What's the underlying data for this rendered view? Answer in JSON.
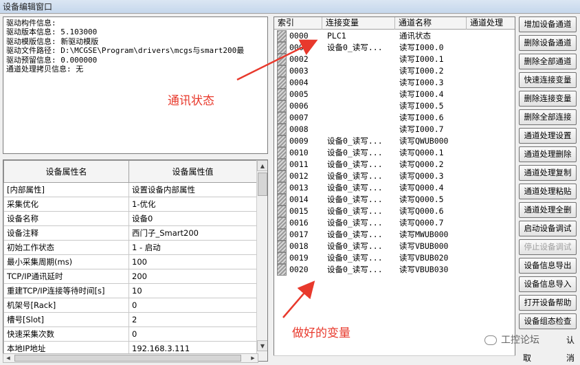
{
  "window": {
    "title": "设备编辑窗口"
  },
  "info_lines": [
    "驱动构件信息:",
    "驱动版本信息: 5.103000",
    "驱动模版信息: 新驱动模版",
    "驱动文件路径: D:\\MCGSE\\Program\\drivers\\mcgs与smart200最",
    "驱动预留信息: 0.000000",
    "通道处理拷贝信息: 无"
  ],
  "props": {
    "headers": [
      "设备属性名",
      "设备属性值"
    ],
    "rows": [
      {
        "name": "[内部属性]",
        "value": "设置设备内部属性"
      },
      {
        "name": "采集优化",
        "value": "1-优化"
      },
      {
        "name": "设备名称",
        "value": "设备0"
      },
      {
        "name": "设备注释",
        "value": "西门子_Smart200"
      },
      {
        "name": "初始工作状态",
        "value": "1 - 启动"
      },
      {
        "name": "最小采集周期(ms)",
        "value": "100"
      },
      {
        "name": "TCP/IP通讯延时",
        "value": "200"
      },
      {
        "name": "重建TCP/IP连接等待时间[s]",
        "value": "10"
      },
      {
        "name": "机架号[Rack]",
        "value": "0"
      },
      {
        "name": "槽号[Slot]",
        "value": "2"
      },
      {
        "name": "快速采集次数",
        "value": "0"
      },
      {
        "name": "本地IP地址",
        "value": "192.168.3.111"
      }
    ]
  },
  "channels": {
    "headers": [
      "索引",
      "连接变量",
      "通道名称",
      "通道处理"
    ],
    "rows": [
      {
        "index": "0000",
        "var": "PLC1",
        "name": "通讯状态"
      },
      {
        "index": "0001",
        "var": "设备0_读写...",
        "name": "读写I000.0"
      },
      {
        "index": "0002",
        "var": "",
        "name": "读写I000.1"
      },
      {
        "index": "0003",
        "var": "",
        "name": "读写I000.2"
      },
      {
        "index": "0004",
        "var": "",
        "name": "读写I000.3"
      },
      {
        "index": "0005",
        "var": "",
        "name": "读写I000.4"
      },
      {
        "index": "0006",
        "var": "",
        "name": "读写I000.5"
      },
      {
        "index": "0007",
        "var": "",
        "name": "读写I000.6"
      },
      {
        "index": "0008",
        "var": "",
        "name": "读写I000.7"
      },
      {
        "index": "0009",
        "var": "设备0_读写...",
        "name": "读写QWUB000"
      },
      {
        "index": "0010",
        "var": "设备0_读写...",
        "name": "读写Q000.1"
      },
      {
        "index": "0011",
        "var": "设备0_读写...",
        "name": "读写Q000.2"
      },
      {
        "index": "0012",
        "var": "设备0_读写...",
        "name": "读写Q000.3"
      },
      {
        "index": "0013",
        "var": "设备0_读写...",
        "name": "读写Q000.4"
      },
      {
        "index": "0014",
        "var": "设备0_读写...",
        "name": "读写Q000.5"
      },
      {
        "index": "0015",
        "var": "设备0_读写...",
        "name": "读写Q000.6"
      },
      {
        "index": "0016",
        "var": "设备0_读写...",
        "name": "读写Q000.7"
      },
      {
        "index": "0017",
        "var": "设备0_读写...",
        "name": "读写MWUB000"
      },
      {
        "index": "0018",
        "var": "设备0_读写...",
        "name": "读写VBUB000"
      },
      {
        "index": "0019",
        "var": "设备0_读写...",
        "name": "读写VBUB020"
      },
      {
        "index": "0020",
        "var": "设备0_读写...",
        "name": "读写VBUB030"
      }
    ]
  },
  "buttons": [
    {
      "label": "增加设备通道",
      "enabled": true
    },
    {
      "label": "删除设备通道",
      "enabled": true
    },
    {
      "label": "删除全部通道",
      "enabled": true
    },
    {
      "label": "快速连接变量",
      "enabled": true
    },
    {
      "label": "删除连接变量",
      "enabled": true
    },
    {
      "label": "删除全部连接",
      "enabled": true
    },
    {
      "label": "通道处理设置",
      "enabled": true
    },
    {
      "label": "通道处理删除",
      "enabled": true
    },
    {
      "label": "通道处理复制",
      "enabled": true
    },
    {
      "label": "通道处理粘贴",
      "enabled": true
    },
    {
      "label": "通道处理全删",
      "enabled": true
    },
    {
      "label": "启动设备调试",
      "enabled": true
    },
    {
      "label": "停止设备调试",
      "enabled": false
    },
    {
      "label": "设备信息导出",
      "enabled": true
    },
    {
      "label": "设备信息导入",
      "enabled": true
    },
    {
      "label": "打开设备帮助",
      "enabled": true
    },
    {
      "label": "设备组态检查",
      "enabled": true
    }
  ],
  "bottom_buttons": {
    "confirm_tail": "认",
    "cancel_head": "取",
    "cancel_tail": "消"
  },
  "annotations": {
    "comm_status": "通讯状态",
    "done_vars": "做好的变量"
  },
  "watermark": "工控论坛",
  "colors": {
    "annotation": "#e8392c"
  }
}
